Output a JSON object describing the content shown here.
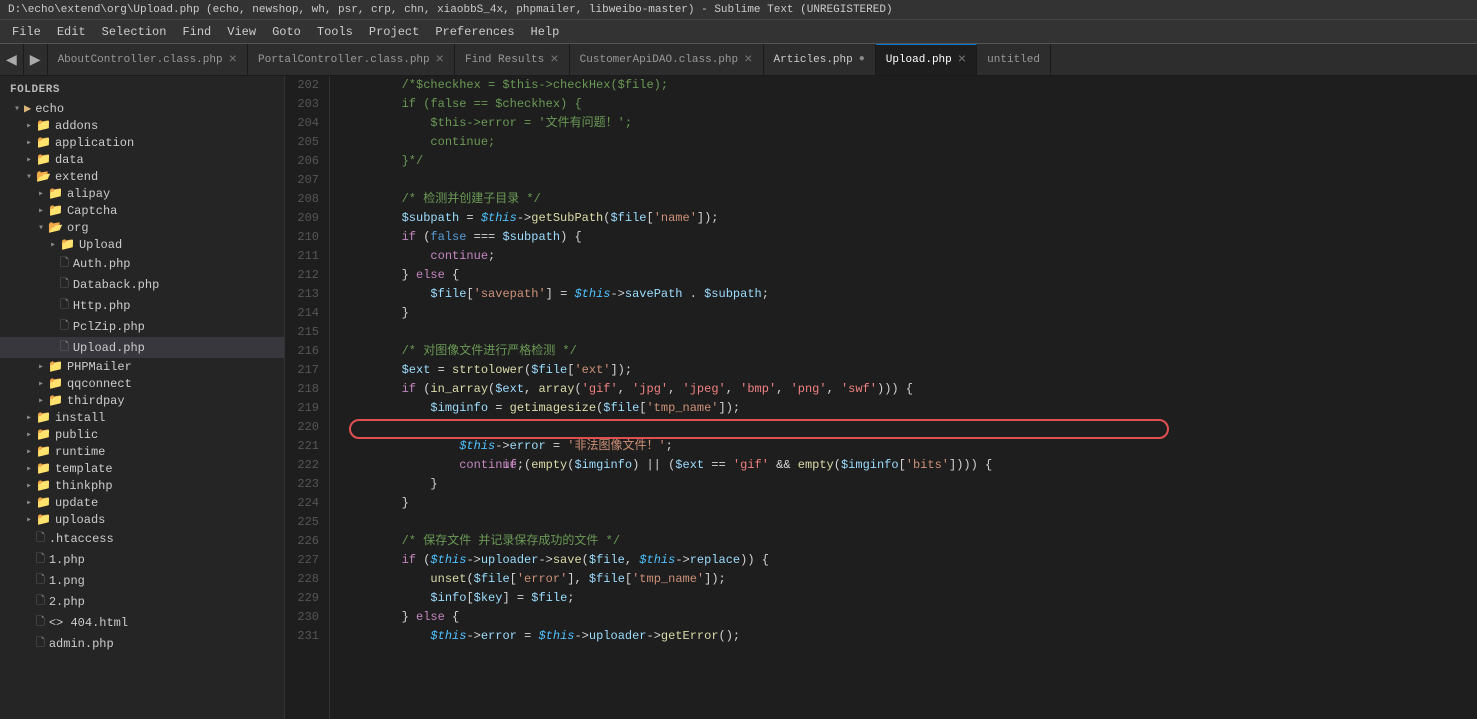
{
  "titlebar": {
    "text": "D:\\echo\\extend\\org\\Upload.php (echo, newshop, wh, psr, crp, chn, xiaobbS_4x, phpmailer, libweibo-master) - Sublime Text (UNREGISTERED)"
  },
  "menubar": {
    "items": [
      "File",
      "Edit",
      "Selection",
      "Find",
      "View",
      "Goto",
      "Tools",
      "Project",
      "Preferences",
      "Help"
    ]
  },
  "tabs": [
    {
      "label": "AboutController.class.php",
      "active": false,
      "modified": false,
      "closeable": true
    },
    {
      "label": "PortalController.class.php",
      "active": false,
      "modified": false,
      "closeable": true
    },
    {
      "label": "Find Results",
      "active": false,
      "modified": false,
      "closeable": true
    },
    {
      "label": "CustomerApiDAO.class.php",
      "active": false,
      "modified": false,
      "closeable": true
    },
    {
      "label": "Articles.php",
      "active": false,
      "modified": true,
      "closeable": true
    },
    {
      "label": "Upload.php",
      "active": true,
      "modified": false,
      "closeable": true
    },
    {
      "label": "untitled",
      "active": false,
      "modified": false,
      "closeable": false
    }
  ],
  "sidebar": {
    "header": "FOLDERS",
    "items": [
      {
        "type": "folder",
        "label": "echo",
        "indent": 1,
        "open": true
      },
      {
        "type": "folder",
        "label": "addons",
        "indent": 2,
        "open": false
      },
      {
        "type": "folder",
        "label": "application",
        "indent": 2,
        "open": false
      },
      {
        "type": "folder",
        "label": "data",
        "indent": 2,
        "open": false
      },
      {
        "type": "folder",
        "label": "extend",
        "indent": 2,
        "open": true
      },
      {
        "type": "folder",
        "label": "alipay",
        "indent": 3,
        "open": false
      },
      {
        "type": "folder",
        "label": "Captcha",
        "indent": 3,
        "open": false
      },
      {
        "type": "folder",
        "label": "org",
        "indent": 3,
        "open": true
      },
      {
        "type": "folder",
        "label": "Upload",
        "indent": 4,
        "open": false
      },
      {
        "type": "file",
        "label": "Auth.php",
        "indent": 4
      },
      {
        "type": "file",
        "label": "Databack.php",
        "indent": 4
      },
      {
        "type": "file",
        "label": "Http.php",
        "indent": 4
      },
      {
        "type": "file",
        "label": "PclZip.php",
        "indent": 4
      },
      {
        "type": "file",
        "label": "Upload.php",
        "indent": 4,
        "active": true
      },
      {
        "type": "folder",
        "label": "PHPMailer",
        "indent": 3,
        "open": false
      },
      {
        "type": "folder",
        "label": "qqconnect",
        "indent": 3,
        "open": false
      },
      {
        "type": "folder",
        "label": "thirdpay",
        "indent": 3,
        "open": false
      },
      {
        "type": "folder",
        "label": "install",
        "indent": 2,
        "open": false
      },
      {
        "type": "folder",
        "label": "public",
        "indent": 2,
        "open": false
      },
      {
        "type": "folder",
        "label": "runtime",
        "indent": 2,
        "open": false
      },
      {
        "type": "folder",
        "label": "template",
        "indent": 2,
        "open": false
      },
      {
        "type": "folder",
        "label": "thinkphp",
        "indent": 2,
        "open": false
      },
      {
        "type": "folder",
        "label": "update",
        "indent": 2,
        "open": false
      },
      {
        "type": "folder",
        "label": "uploads",
        "indent": 2,
        "open": false
      },
      {
        "type": "file",
        "label": ".htaccess",
        "indent": 2
      },
      {
        "type": "file",
        "label": "1.php",
        "indent": 2
      },
      {
        "type": "file",
        "label": "1.png",
        "indent": 2
      },
      {
        "type": "file",
        "label": "2.php",
        "indent": 2
      },
      {
        "type": "file",
        "label": "404.html",
        "indent": 2
      },
      {
        "type": "file",
        "label": "admin.php",
        "indent": 2
      }
    ]
  },
  "editor": {
    "lines": [
      {
        "num": 202,
        "content": "comment_start",
        "text": "        /*$checkhex = $this->checkHex($file);"
      },
      {
        "num": 203,
        "content": "comment",
        "text": "        if (false == $checkhex) {"
      },
      {
        "num": 204,
        "content": "comment",
        "text": "            $this->error = '文件有问题！';"
      },
      {
        "num": 205,
        "content": "comment",
        "text": "            continue;"
      },
      {
        "num": 206,
        "content": "comment_end",
        "text": "        }*/"
      },
      {
        "num": 207,
        "content": "blank",
        "text": ""
      },
      {
        "num": 208,
        "content": "comment_block",
        "text": "        /* 检测并创建子目录 */"
      },
      {
        "num": 209,
        "content": "code",
        "text": "        $subpath = $this->getSubPath($file['name']);"
      },
      {
        "num": 210,
        "content": "code",
        "text": "        if (false === $subpath) {"
      },
      {
        "num": 211,
        "content": "code",
        "text": "            continue;"
      },
      {
        "num": 212,
        "content": "code",
        "text": "        } else {"
      },
      {
        "num": 213,
        "content": "code",
        "text": "            $file['savepath'] = $this->savePath . $subpath;"
      },
      {
        "num": 214,
        "content": "code",
        "text": "        }"
      },
      {
        "num": 215,
        "content": "blank",
        "text": ""
      },
      {
        "num": 216,
        "content": "comment_block",
        "text": "        /* 对图像文件进行严格检测 */"
      },
      {
        "num": 217,
        "content": "code",
        "text": "        $ext = strtolower($file['ext']);"
      },
      {
        "num": 218,
        "content": "code",
        "text": "        if (in_array($ext, array('gif', 'jpg', 'jpeg', 'bmp', 'png', 'swf'))) {"
      },
      {
        "num": 219,
        "content": "code",
        "text": "            $imginfo = getimagesize($file['tmp_name']);"
      },
      {
        "num": 220,
        "content": "code_oval",
        "text": "            if (empty($imginfo) || ($ext == 'gif' && empty($imginfo['bits']))) {"
      },
      {
        "num": 221,
        "content": "code",
        "text": "                $this->error = '非法图像文件！';"
      },
      {
        "num": 222,
        "content": "code",
        "text": "                continue;"
      },
      {
        "num": 223,
        "content": "code",
        "text": "            }"
      },
      {
        "num": 224,
        "content": "code",
        "text": "        }"
      },
      {
        "num": 225,
        "content": "blank",
        "text": ""
      },
      {
        "num": 226,
        "content": "comment_block",
        "text": "        /* 保存文件 并记录保存成功的文件 */"
      },
      {
        "num": 227,
        "content": "code",
        "text": "        if ($this->uploader->save($file, $this->replace)) {"
      },
      {
        "num": 228,
        "content": "code",
        "text": "            unset($file['error'], $file['tmp_name']);"
      },
      {
        "num": 229,
        "content": "code",
        "text": "            $info[$key] = $file;"
      },
      {
        "num": 230,
        "content": "code",
        "text": "        } else {"
      },
      {
        "num": 231,
        "content": "code",
        "text": "            $this->error = $this->uploader->getError();"
      }
    ]
  }
}
